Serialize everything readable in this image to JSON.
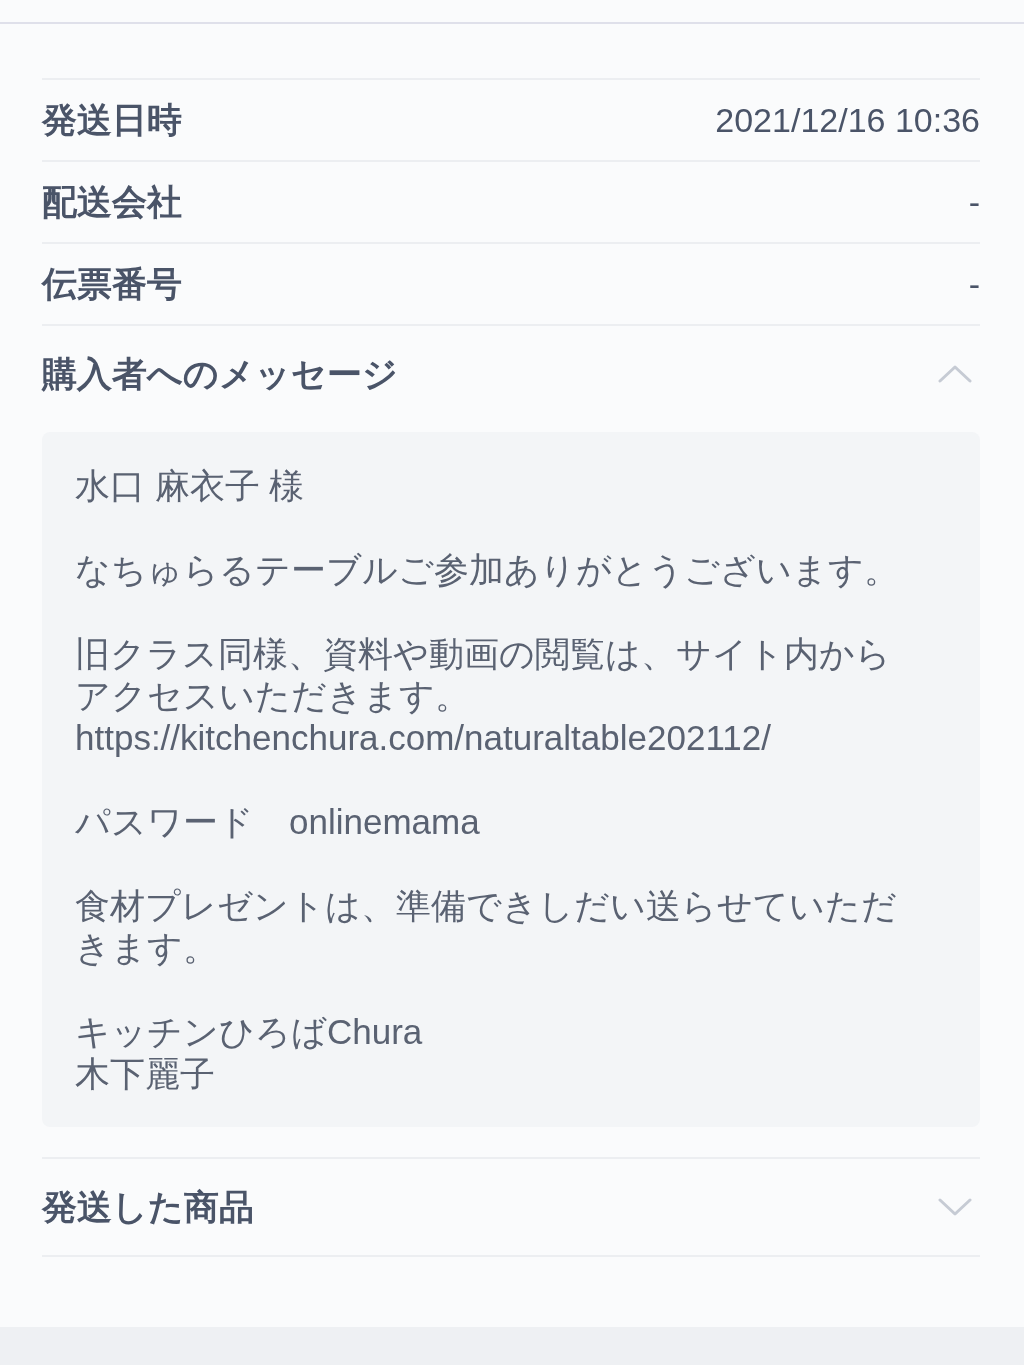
{
  "details": [
    {
      "label": "発送日時",
      "value": "2021/12/16 10:36"
    },
    {
      "label": "配送会社",
      "value": "-"
    },
    {
      "label": "伝票番号",
      "value": "-"
    }
  ],
  "sections": [
    {
      "title": "購入者へのメッセージ",
      "expanded": true,
      "message": [
        [
          "水口 麻衣子 様"
        ],
        [
          "なちゅらるテーブルご参加ありがとうございます。"
        ],
        [
          "旧クラス同様、資料や動画の閲覧は、サイト内から",
          "アクセスいただきます。",
          "https://kitchenchura.com/naturaltable202112/"
        ],
        [
          "パスワード　onlinemama"
        ],
        [
          "食材プレゼントは、準備できしだい送らせていただ",
          "きます。"
        ],
        [
          "キッチンひろばChura",
          "木下麗子"
        ]
      ]
    },
    {
      "title": "発送した商品",
      "expanded": false
    }
  ]
}
